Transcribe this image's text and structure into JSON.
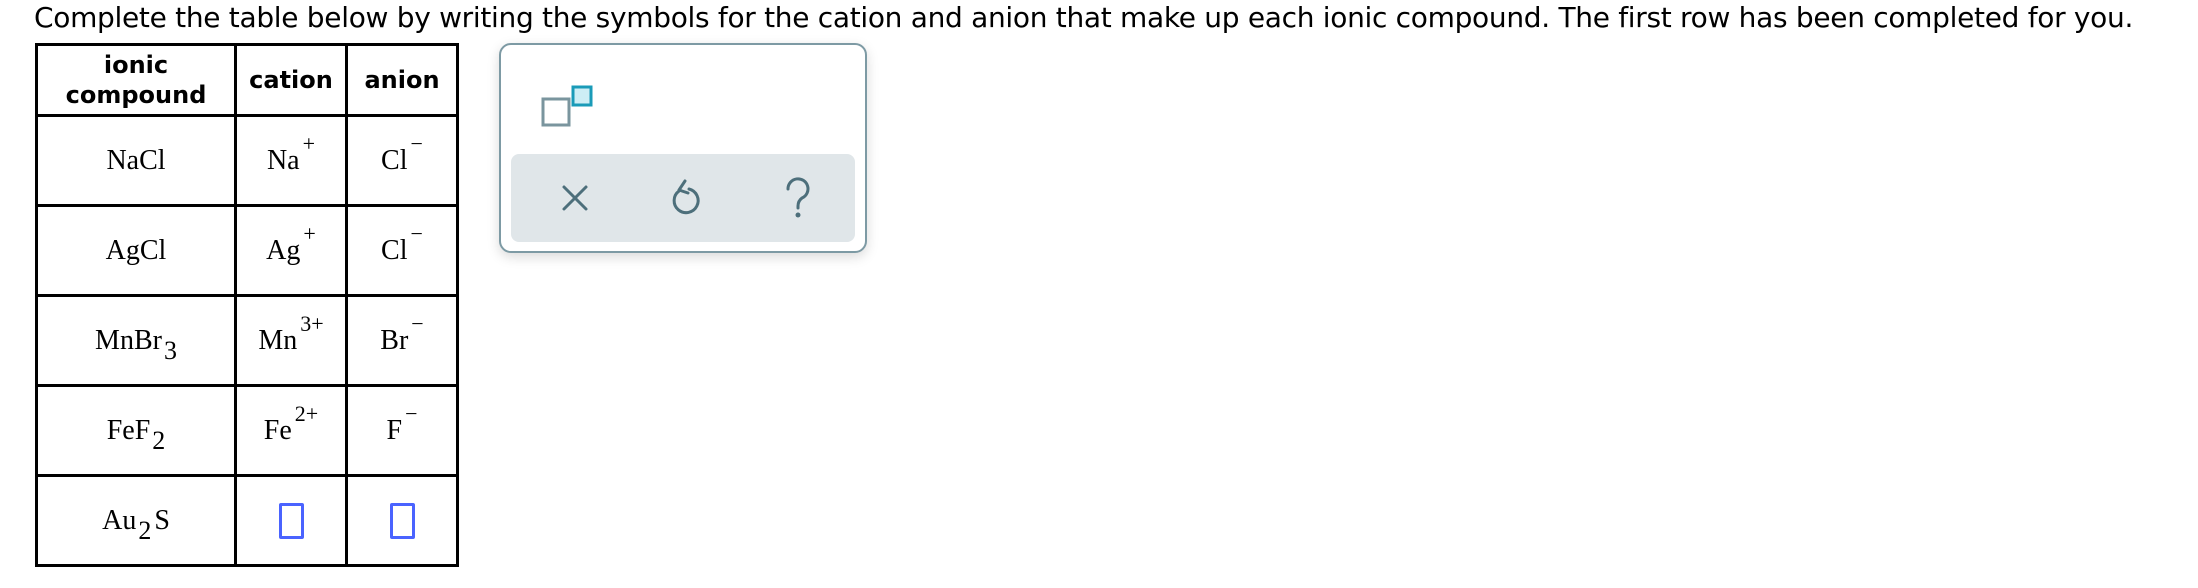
{
  "instructions": "Complete the table below by writing the symbols for the cation and anion that make up each ionic compound. The first row has been completed for you.",
  "table": {
    "headers": {
      "compound_line1": "ionic",
      "compound_line2": "compound",
      "cation": "cation",
      "anion": "anion"
    },
    "rows": [
      {
        "compound": {
          "base": "NaCl",
          "sub": "",
          "tail": ""
        },
        "cation": {
          "symbol": "Na",
          "charge": "+"
        },
        "anion": {
          "symbol": "Cl",
          "charge": "−"
        }
      },
      {
        "compound": {
          "base": "AgCl",
          "sub": "",
          "tail": ""
        },
        "cation": {
          "symbol": "Ag",
          "charge": "+"
        },
        "anion": {
          "symbol": "Cl",
          "charge": "−"
        }
      },
      {
        "compound": {
          "base": "MnBr",
          "sub": "3",
          "tail": ""
        },
        "cation": {
          "symbol": "Mn",
          "charge": "3+"
        },
        "anion": {
          "symbol": "Br",
          "charge": "−"
        }
      },
      {
        "compound": {
          "base": "FeF",
          "sub": "2",
          "tail": ""
        },
        "cation": {
          "symbol": "Fe",
          "charge": "2+"
        },
        "anion": {
          "symbol": "F",
          "charge": "−"
        }
      },
      {
        "compound": {
          "base": "Au",
          "sub": "2",
          "tail": "S"
        },
        "cation": {
          "value": ""
        },
        "anion": {
          "value": ""
        }
      }
    ]
  },
  "panel": {
    "tools": [
      {
        "icon": "superscript-template-icon"
      },
      {
        "icon": "clear-x-icon"
      },
      {
        "icon": "undo-icon"
      },
      {
        "icon": "help-question-icon"
      }
    ],
    "colors": {
      "icon": "#4d6f7b",
      "panel_border": "#7d9aa4",
      "toolbar_bg": "#e0e6e9",
      "accent": "#1a9bb8",
      "accent_fill": "#cdeef5",
      "input_border": "#4a63ff"
    }
  }
}
